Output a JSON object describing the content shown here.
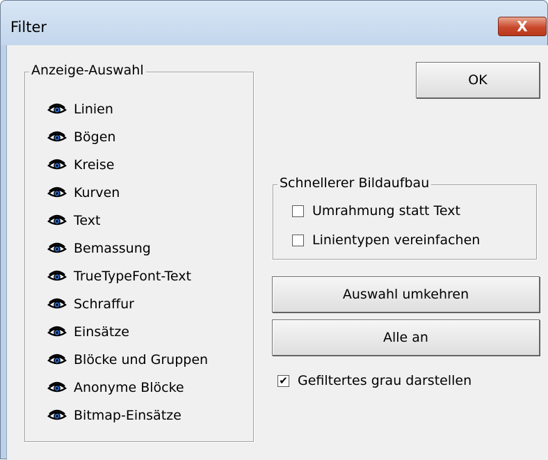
{
  "window": {
    "title": "Filter",
    "close_glyph": "X"
  },
  "display_group": {
    "legend": "Anzeige-Auswahl",
    "items": [
      {
        "label": "Linien",
        "icon": "eye-icon"
      },
      {
        "label": "Bögen",
        "icon": "eye-icon"
      },
      {
        "label": "Kreise",
        "icon": "eye-icon"
      },
      {
        "label": "Kurven",
        "icon": "eye-icon"
      },
      {
        "label": "Text",
        "icon": "eye-icon"
      },
      {
        "label": "Bemassung",
        "icon": "eye-icon"
      },
      {
        "label": "TrueTypeFont-Text",
        "icon": "eye-icon"
      },
      {
        "label": "Schraffur",
        "icon": "eye-icon"
      },
      {
        "label": "Einsätze",
        "icon": "eye-icon"
      },
      {
        "label": "Blöcke und Gruppen",
        "icon": "eye-icon"
      },
      {
        "label": "Anonyme Blöcke",
        "icon": "eye-icon"
      },
      {
        "label": "Bitmap-Einsätze",
        "icon": "eye-icon"
      }
    ]
  },
  "buttons": {
    "ok": "OK",
    "invert_selection": "Auswahl umkehren",
    "all_on": "Alle an"
  },
  "fast_redraw_group": {
    "legend": "Schnellerer Bildaufbau",
    "frame_instead_of_text": {
      "label": "Umrahmung statt Text",
      "checked": false
    },
    "simplify_linetypes": {
      "label": "Linientypen vereinfachen",
      "checked": false
    }
  },
  "show_filtered_grey": {
    "label": "Gefiltertes grau darstellen",
    "checked": true
  },
  "colors": {
    "eye_outline": "#000000",
    "eye_iris": "#2f6fd0",
    "close_button": "#c9492c"
  }
}
